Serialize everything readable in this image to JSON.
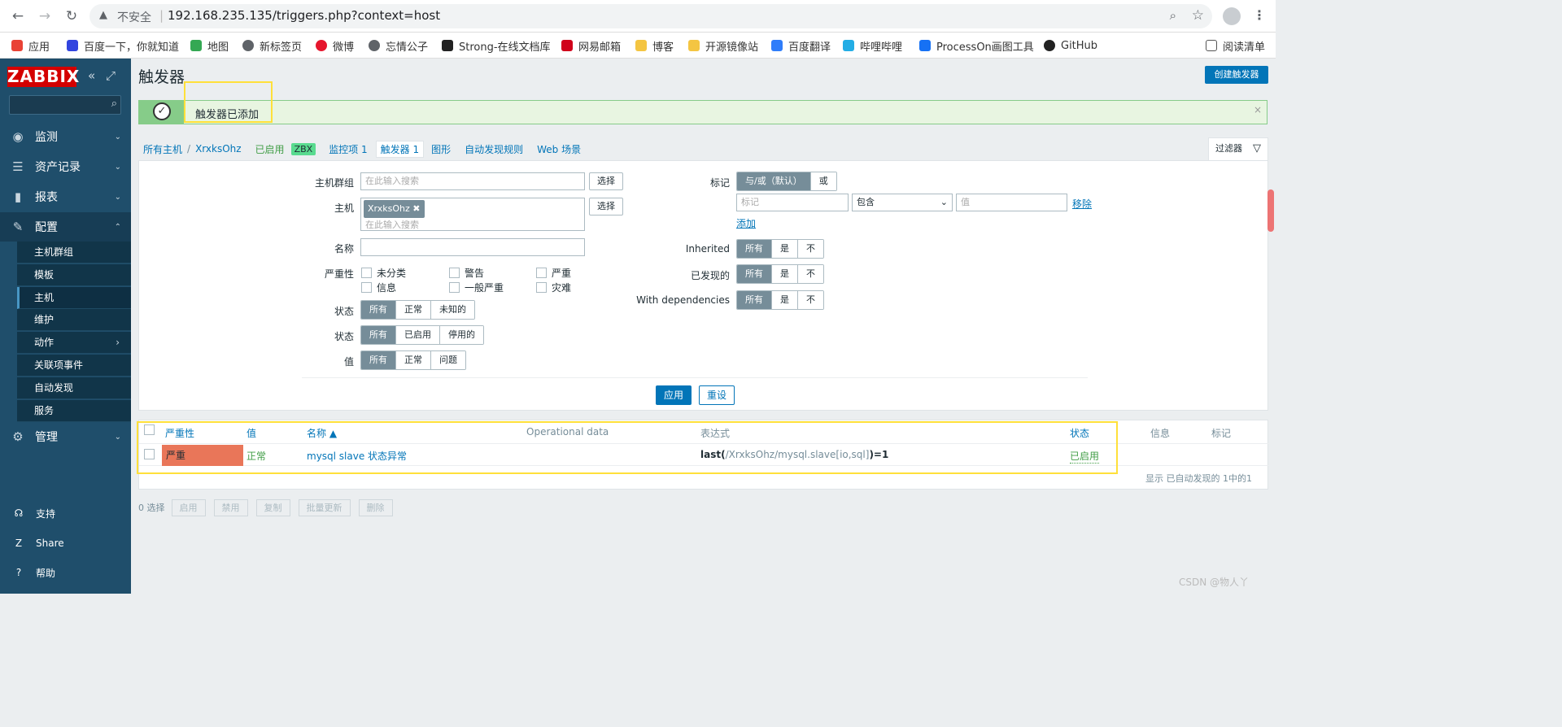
{
  "browser": {
    "back_icon": "←",
    "forward_icon": "→",
    "reload_icon": "↻",
    "warning_icon": "▲",
    "insecure_label": "不安全",
    "url": "192.168.235.135/triggers.php?context=host",
    "zoom_icon": "⌕",
    "star_icon": "☆",
    "menu_icon": "⋮"
  },
  "bookmarks": [
    {
      "label": "应用",
      "color": "#e94235"
    },
    {
      "label": "百度一下，你就知道",
      "color": "#3245df"
    },
    {
      "label": "地图",
      "color": "#34a853"
    },
    {
      "label": "新标签页",
      "color": "#5f6368"
    },
    {
      "label": "微博",
      "color": "#e6162d"
    },
    {
      "label": "忘情公子",
      "color": "#5f6368"
    },
    {
      "label": "Strong-在线文档库",
      "color": "#222222"
    },
    {
      "label": "网易邮箱",
      "color": "#d0021b"
    },
    {
      "label": "博客",
      "color": "#f4c542"
    },
    {
      "label": "开源镜像站",
      "color": "#f4c542"
    },
    {
      "label": "百度翻译",
      "color": "#2f7dfa"
    },
    {
      "label": "哔哩哔哩",
      "color": "#23ade5"
    },
    {
      "label": "ProcessOn画图工具",
      "color": "#1671f4"
    },
    {
      "label": "GitHub",
      "color": "#222222"
    }
  ],
  "reading_list": "阅读清单",
  "sidebar": {
    "logo": "ZABBIX",
    "collapse_icon": "«",
    "kiosk_icon": "⤢",
    "search_icon": "⌕",
    "menu": [
      {
        "label": "监测",
        "icon": "◉",
        "chev": "⌄"
      },
      {
        "label": "资产记录",
        "icon": "☰",
        "chev": "⌄"
      },
      {
        "label": "报表",
        "icon": "▮",
        "chev": "⌄"
      },
      {
        "label": "配置",
        "icon": "✎",
        "chev": "⌃"
      }
    ],
    "submenu": [
      "主机群组",
      "模板",
      "主机",
      "维护",
      "动作",
      "关联项事件",
      "自动发现",
      "服务"
    ],
    "submenu_chev": "›",
    "admin": {
      "label": "管理",
      "icon": "⚙",
      "chev": "⌄"
    },
    "bottom": [
      {
        "label": "支持",
        "icon": "☊"
      },
      {
        "label": "Share",
        "icon": "Z"
      },
      {
        "label": "帮助",
        "icon": "?"
      }
    ]
  },
  "page": {
    "title": "触发器",
    "create_button": "创建触发器",
    "message": "触发器已添加",
    "ok_icon": "✓",
    "close_icon": "×"
  },
  "crumbs": {
    "all_hosts": "所有主机",
    "slash": "/",
    "host": "XrxksOhz",
    "enabled": "已启用",
    "zbx": "ZBX",
    "items": "监控项 1",
    "triggers": "触发器 1",
    "graphs": "图形",
    "discovery": "自动发现规则",
    "web": "Web 场景"
  },
  "filter": {
    "tab_label": "过滤器",
    "tab_icon": "▽",
    "host_group_label": "主机群组",
    "host_group_placeholder": "在此输入搜索",
    "select_label": "选择",
    "host_label": "主机",
    "host_tag": "XrxksOhz",
    "host_tag_x": "✖",
    "host_placeholder": "在此输入搜索",
    "name_label": "名称",
    "severity_label": "严重性",
    "severities": [
      "未分类",
      "警告",
      "严重",
      "信息",
      "一般严重",
      "灾难"
    ],
    "state_label": "状态",
    "state_options": [
      "所有",
      "正常",
      "未知的"
    ],
    "status_label": "状态",
    "status_options": [
      "所有",
      "已启用",
      "停用的"
    ],
    "value_label": "值",
    "value_options": [
      "所有",
      "正常",
      "问题"
    ],
    "tags_label": "标记",
    "tags_mode": [
      "与/或（默认）",
      "或"
    ],
    "tag_placeholder": "标记",
    "tag_operator": "包含",
    "tag_value_placeholder": "值",
    "remove": "移除",
    "add": "添加",
    "inherited_label": "Inherited",
    "discovered_label": "已发现的",
    "dependencies_label": "With dependencies",
    "yes_no": [
      "所有",
      "是",
      "不"
    ],
    "apply": "应用",
    "reset": "重设"
  },
  "table": {
    "headers": [
      "严重性",
      "值",
      "名称 ▲",
      "Operational data",
      "表达式",
      "状态",
      "信息",
      "标记"
    ],
    "row": {
      "severity": "严重",
      "value": "正常",
      "name": "mysql slave 状态异常",
      "expr_fn": "last(",
      "expr_item": "/XrxksOhz/mysql.slave[io,sql]",
      "expr_tail": ")=1",
      "status": "已启用"
    },
    "footer": "显示 已自动发现的 1中的1"
  },
  "actions": {
    "selected": "0 选择",
    "buttons": [
      "启用",
      "禁用",
      "复制",
      "批量更新",
      "删除"
    ]
  },
  "watermark": "CSDN @物人丫"
}
